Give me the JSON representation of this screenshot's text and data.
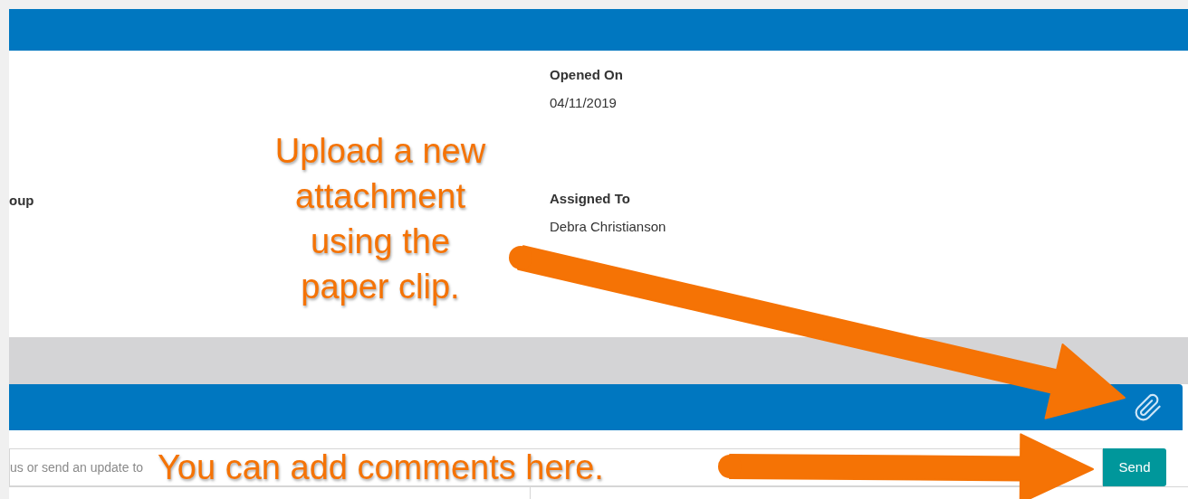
{
  "details": {
    "left_label": "oup",
    "fields": [
      {
        "label": "Opened On",
        "value": "04/11/2019"
      },
      {
        "label": "Assigned To",
        "value": "Debra Christianson"
      }
    ]
  },
  "comment_form": {
    "placeholder": "us or send an update to",
    "send_button": "Send"
  },
  "annotations": [
    {
      "kind": "callout",
      "lines": [
        "Upload a new",
        "attachment",
        "using the",
        "paper clip."
      ]
    },
    {
      "kind": "inline",
      "lines": [
        "You can add comments here."
      ]
    }
  ]
}
